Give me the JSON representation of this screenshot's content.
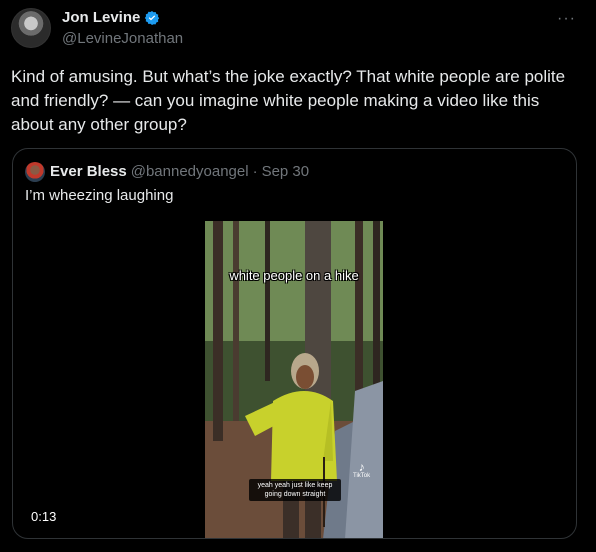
{
  "author": {
    "display_name": "Jon Levine",
    "handle": "@LevineJonathan",
    "verified": true,
    "avatar_icon": "profile-photo"
  },
  "more_menu": {
    "label": "···",
    "icon": "more-horizontal-icon"
  },
  "tweet_text": "Kind of amusing. But what’s the joke exactly? That white people are polite and friendly? — can you imagine white people making a video like this about any other group?",
  "quoted": {
    "display_name": "Ever Bless",
    "handle": "@bannedyoangel",
    "separator": "·",
    "date": "Sep 30",
    "text": "I’m wheezing laughing",
    "video": {
      "overlay_caption": "white people on a hike",
      "subtitle": "yeah yeah just like keep going down straight",
      "watermark": "TikTok",
      "duration": "0:13"
    }
  },
  "colors": {
    "background": "#000000",
    "text_primary": "#e7e9ea",
    "text_secondary": "#71767b",
    "verified_blue": "#1d9bf0",
    "border": "#2f3336"
  }
}
